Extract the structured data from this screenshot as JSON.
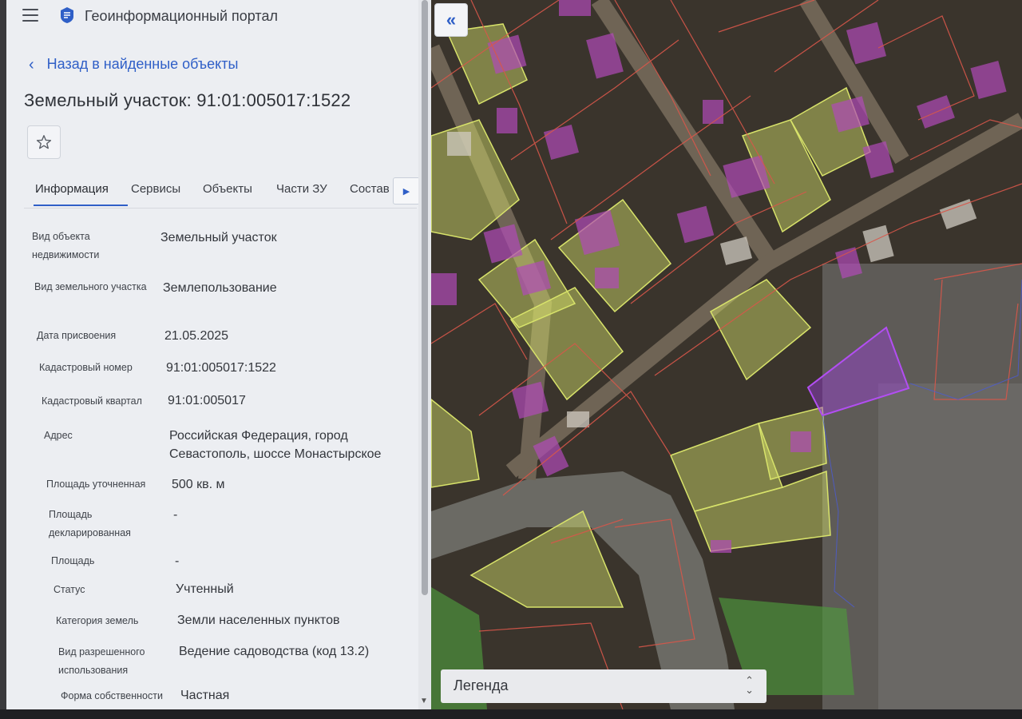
{
  "app": {
    "title": "Геоинформационный портал"
  },
  "back_link": "Назад в найденные объекты",
  "object_title": "Земельный участок: 91:01:005017:1522",
  "tabs": [
    {
      "label": "Информация",
      "active": true
    },
    {
      "label": "Сервисы"
    },
    {
      "label": "Объекты"
    },
    {
      "label": "Части ЗУ"
    },
    {
      "label": "Состав"
    }
  ],
  "info": [
    {
      "label": "Вид объекта недвижимости",
      "value": "Земельный участок"
    },
    {
      "label": "Вид земельного участка",
      "value": "Землепользование"
    },
    {
      "label": "Дата присвоения",
      "value": "21.05.2025"
    },
    {
      "label": "Кадастровый номер",
      "value": "91:01:005017:1522"
    },
    {
      "label": "Кадастровый квартал",
      "value": "91:01:005017"
    },
    {
      "label": "Адрес",
      "value": "Российская Федерация, город Севастополь, шоссе Монастырское"
    },
    {
      "label": "Площадь уточненная",
      "value": "500 кв. м"
    },
    {
      "label": "Площадь декларированная",
      "value": "-"
    },
    {
      "label": "Площадь",
      "value": "-"
    },
    {
      "label": "Статус",
      "value": "Учтенный"
    },
    {
      "label": "Категория земель",
      "value": "Земли населенных пунктов"
    },
    {
      "label": "Вид разрешенного использования",
      "value": "Ведение садоводства (код 13.2)"
    },
    {
      "label": "Форма собственности",
      "value": "Частная"
    }
  ],
  "map": {
    "collapse_icon": "double-chevron-left-icon",
    "legend_label": "Легенда",
    "legend_icon": "expand-updown-icon"
  },
  "colors": {
    "accent": "#2f5fc7",
    "panel_bg": "#eceef2",
    "parcel_yellow": "#d8e36a",
    "building_magenta": "#b04ab8",
    "selected_parcel": "#9b3fd6",
    "boundary": "#d8574a",
    "green_zone": "#4f9a3e"
  }
}
